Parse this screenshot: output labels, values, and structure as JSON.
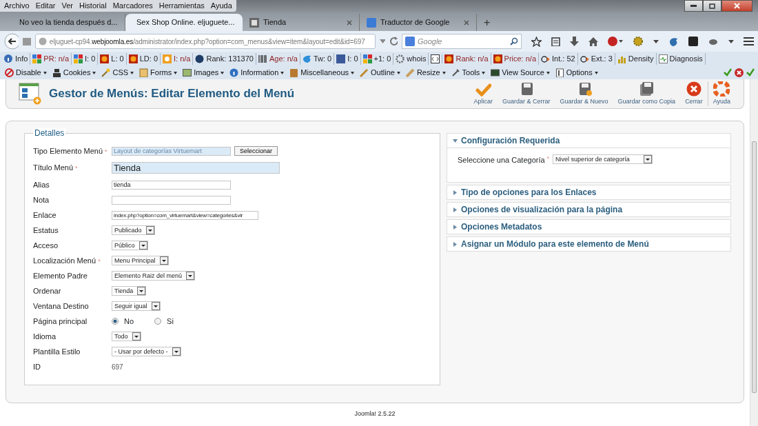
{
  "menubar": [
    "Archivo",
    "Editar",
    "Ver",
    "Historial",
    "Marcadores",
    "Herramientas",
    "Ayuda"
  ],
  "tabs": [
    {
      "label": "No veo la tienda después d...",
      "selected": false
    },
    {
      "label": "Sex Shop Online. eljuguete...",
      "selected": true
    },
    {
      "label": "Tienda",
      "selected": false
    },
    {
      "label": "Traductor de Google",
      "selected": false
    }
  ],
  "new_tab": "+",
  "address": "eljuguet-cp94.**webjoomla.es**/administrator/index.php?option=com_menus&view=item&layout=edit&id=697",
  "search": {
    "placeholder": "Google"
  },
  "seo_bar": [
    {
      "label": "Info",
      "warning": false
    },
    {
      "label": "PR: n/a",
      "warning": true
    },
    {
      "label": "I: 0",
      "warning": false
    },
    {
      "label": "L: 0",
      "warning": false
    },
    {
      "label": "LD: 0",
      "warning": false
    },
    {
      "label": "I: n/a",
      "warning": true
    },
    {
      "label": "Rank: 131370",
      "warning": false
    },
    {
      "label": "Age: n/a",
      "warning": true
    },
    {
      "label": "Tw: 0",
      "warning": false
    },
    {
      "label": "I: 0",
      "warning": false
    },
    {
      "label": "+1: 0",
      "warning": false
    },
    {
      "label": "whois",
      "warning": false
    },
    {
      "label": "Rank: n/a",
      "warning": true
    },
    {
      "label": "Price: n/a",
      "warning": true
    },
    {
      "label": "Int.: 52",
      "warning": false
    },
    {
      "label": "Ext.: 3",
      "warning": false
    },
    {
      "label": "Density",
      "warning": false
    },
    {
      "label": "Diagnosis",
      "warning": false
    }
  ],
  "dev_bar": [
    "Disable",
    "Cookies",
    "CSS",
    "Forms",
    "Images",
    "Information",
    "Miscellaneous",
    "Outline",
    "Resize",
    "Tools",
    "View Source",
    "Options"
  ],
  "page_title": "Gestor de Menús: Editar Elemento del Menú",
  "toolbar": [
    {
      "label": "Aplicar",
      "kind": "apply"
    },
    {
      "label": "Guardar & Cerrar",
      "kind": "save"
    },
    {
      "label": "Guardar & Nuevo",
      "kind": "save-new"
    },
    {
      "label": "Guardar como Copia",
      "kind": "save-copy"
    },
    {
      "label": "Cerrar",
      "kind": "close"
    },
    {
      "label": "Ayuda",
      "kind": "help"
    }
  ],
  "details": {
    "legend": "Detalles",
    "fields": [
      {
        "label": "Tipo Elemento Menú",
        "required_mark": "*",
        "kind": "type",
        "value": "Layout de categorías Virtuemart",
        "button": "Seleccionar"
      },
      {
        "label": "Título Menú",
        "required_mark": "*",
        "kind": "title",
        "value": "Tienda"
      },
      {
        "label": "Alias",
        "kind": "text",
        "value": "tienda"
      },
      {
        "label": "Nota",
        "kind": "text"
      },
      {
        "label": "Enlace",
        "kind": "link",
        "value": "index.php?option=com_virtuemart&view=categories&vir"
      },
      {
        "label": "Estatus",
        "kind": "select",
        "value": "Publicado"
      },
      {
        "label": "Acceso",
        "kind": "select",
        "value": "Público"
      },
      {
        "label": "Localización Menú",
        "required_mark": "*",
        "kind": "select",
        "value": "Menu Principal"
      },
      {
        "label": "Elemento Padre",
        "kind": "select",
        "value": "Elemento Raiz del menú"
      },
      {
        "label": "Ordenar",
        "kind": "select",
        "value": "Tienda"
      },
      {
        "label": "Ventana Destino",
        "kind": "select",
        "value": "Seguir igual"
      },
      {
        "label": "Página principal",
        "kind": "radio",
        "options": [
          {
            "label": "No",
            "selected": true
          },
          {
            "label": "Si",
            "selected": false
          }
        ]
      },
      {
        "label": "Idioma",
        "kind": "select",
        "value": "Todo"
      },
      {
        "label": "Plantilla Estilo",
        "kind": "select",
        "value": "- Usar por defecto -"
      },
      {
        "label": "ID",
        "kind": "static",
        "value": "697"
      }
    ]
  },
  "sections": [
    {
      "title": "Configuración Requerida",
      "expanded": true,
      "fields": [
        {
          "label": "Seleccione una Categoría",
          "required_mark": "*",
          "value": "Nivel superior de categoría"
        }
      ]
    },
    {
      "title": "Tipo de opciones para los Enlaces",
      "expanded": false
    },
    {
      "title": "Opciones de visualización para la página",
      "expanded": false
    },
    {
      "title": "Opciones Metadatos",
      "expanded": false
    },
    {
      "title": "Asignar un Módulo para este elemento de Menú",
      "expanded": false
    }
  ],
  "footer": "Joomla! 2.5.22"
}
